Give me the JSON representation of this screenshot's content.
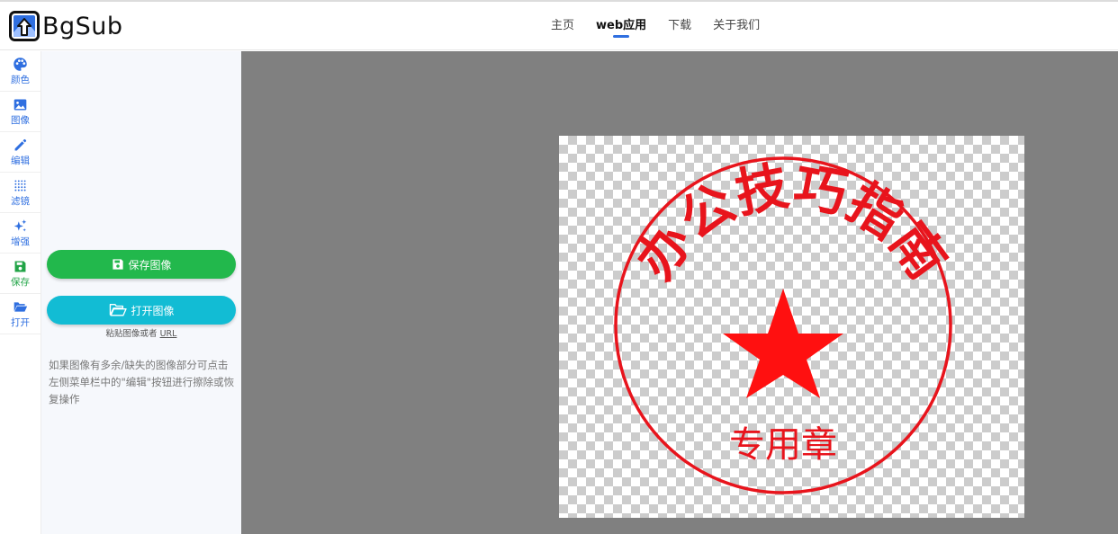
{
  "header": {
    "logo_text": "BgSub",
    "nav": [
      {
        "label": "主页",
        "active": false
      },
      {
        "label": "web应用",
        "active": true
      },
      {
        "label": "下载",
        "active": false
      },
      {
        "label": "关于我们",
        "active": false
      }
    ]
  },
  "toolbar": {
    "items": [
      {
        "label": "颜色",
        "icon": "palette-icon"
      },
      {
        "label": "图像",
        "icon": "image-icon"
      },
      {
        "label": "编辑",
        "icon": "pencil-icon"
      },
      {
        "label": "滤镜",
        "icon": "dots-grid-icon"
      },
      {
        "label": "增强",
        "icon": "sparkles-icon"
      },
      {
        "label": "保存",
        "icon": "floppy-disk-icon"
      },
      {
        "label": "打开",
        "icon": "folder-open-icon"
      }
    ]
  },
  "panel": {
    "save_label": "保存图像",
    "open_label": "打开图像",
    "paste_hint": "粘贴图像或者",
    "paste_link": "URL",
    "help_text": "如果图像有多余/缺失的图像部分可点击左侧菜单栏中的\"编辑\"按钮进行擦除或恢复操作"
  },
  "stamp": {
    "top_text": "办公技巧指南",
    "bottom_text": "专用章",
    "color": "#e8141c"
  },
  "colors": {
    "accent": "#2f6fe0",
    "save_green": "#22b84c",
    "open_cyan": "#12bcd4",
    "canvas_bg": "#808080"
  }
}
